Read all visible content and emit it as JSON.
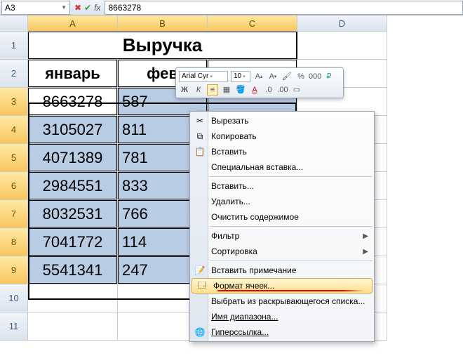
{
  "formula_bar": {
    "cell_ref": "A3",
    "fx_label": "fx",
    "value": "8663278"
  },
  "columns": [
    "A",
    "B",
    "C",
    "D"
  ],
  "rows": [
    "1",
    "2",
    "3",
    "4",
    "5",
    "6",
    "7",
    "8",
    "9",
    "10",
    "11"
  ],
  "selected_cols": [
    "A",
    "B",
    "C"
  ],
  "selected_rows": [
    "3",
    "4",
    "5",
    "6",
    "7",
    "8",
    "9"
  ],
  "title": "Выручка",
  "months": {
    "a": "январь",
    "b": "фев",
    "c": ""
  },
  "data": {
    "a": [
      "8663278",
      "3105027",
      "4071389",
      "2984551",
      "8032531",
      "7041772",
      "5541341"
    ],
    "b": [
      "587",
      "811",
      "781",
      "833",
      "766",
      "114",
      "247"
    ],
    "c_partial": ""
  },
  "mini_toolbar": {
    "font_name": "Arial Cyr",
    "font_size": "10"
  },
  "context_menu": {
    "cut": "Вырезать",
    "copy": "Копировать",
    "paste": "Вставить",
    "paste_special": "Специальная вставка...",
    "insert": "Вставить...",
    "delete": "Удалить...",
    "clear": "Очистить содержимое",
    "filter": "Фильтр",
    "sort": "Сортировка",
    "comment": "Вставить примечание",
    "format_cells": "Формат ячеек...",
    "dropdown_pick": "Выбрать из раскрывающегося списка...",
    "range_name": "Имя диапазона...",
    "hyperlink": "Гиперссылка..."
  },
  "colors": {
    "selection": "#b8cce4",
    "header_sel": "#f7c65e",
    "menu_hover": "#ffe08a",
    "red": "#e00000"
  }
}
